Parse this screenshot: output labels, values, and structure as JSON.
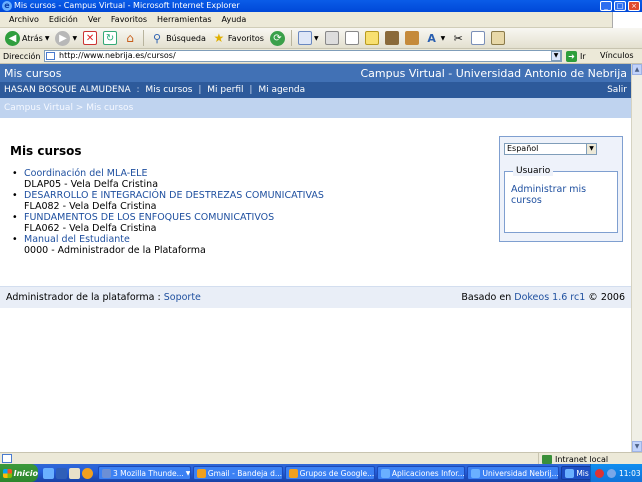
{
  "window": {
    "title": "Mis cursos - Campus Virtual - Microsoft Internet Explorer"
  },
  "menubar": {
    "items": [
      "Archivo",
      "Edición",
      "Ver",
      "Favoritos",
      "Herramientas",
      "Ayuda"
    ]
  },
  "toolbar": {
    "back_label": "Atrás",
    "search_label": "Búsqueda",
    "favorites_label": "Favoritos"
  },
  "address": {
    "label": "Dirección",
    "url": "http://www.nebrija.es/cursos/",
    "go_label": "Ir",
    "links_label": "Vínculos"
  },
  "site": {
    "section_title": "Mis cursos",
    "campus_title": "Campus Virtual - Universidad Antonio de Nebrija",
    "user_name": "HASAN BOSQUE ALMUDENA",
    "nav": [
      "Mis cursos",
      "Mi perfil",
      "Mi agenda"
    ],
    "logout": "Salir",
    "breadcrumb": "Campus Virtual > Mis cursos",
    "page_title": "Mis cursos",
    "courses": [
      {
        "title": "Coordinación del MLA-ELE",
        "meta": "DLAP05 - Vela Delfa Cristina"
      },
      {
        "title": "DESARROLLO E INTEGRACIÓN DE DESTREZAS COMUNICATIVAS",
        "meta": "FLA082 - Vela Delfa Cristina"
      },
      {
        "title": "FUNDAMENTOS DE LOS ENFOQUES COMUNICATIVOS",
        "meta": "FLA062 - Vela Delfa Cristina"
      },
      {
        "title": "Manual del Estudiante",
        "meta": "0000 - Administrador de la Plataforma"
      }
    ],
    "language": "Español",
    "user_box_title": "Usuario",
    "admin_link": "Administrar mis cursos",
    "footer": {
      "admin_text": "Administrador de la plataforma :",
      "support_link": "Soporte",
      "based_on": "Basado en",
      "dokeos_link": "Dokeos 1.6 rc1",
      "copyright": "© 2006"
    }
  },
  "status": {
    "zone": "Intranet local"
  },
  "taskbar": {
    "start": "Inicio",
    "tasks": [
      "3 Mozilla Thunde...",
      "Gmail - Bandeja d...",
      "Grupos de Google...",
      "Aplicaciones Infor...",
      "Universidad Nebrij...",
      "Mis cursos - Ca..."
    ],
    "clock": "11:03"
  },
  "colors": {
    "header_blue": "#4171b5",
    "link_blue": "#1e4f9f",
    "breadcrumb_bg": "#bfd3ef"
  }
}
